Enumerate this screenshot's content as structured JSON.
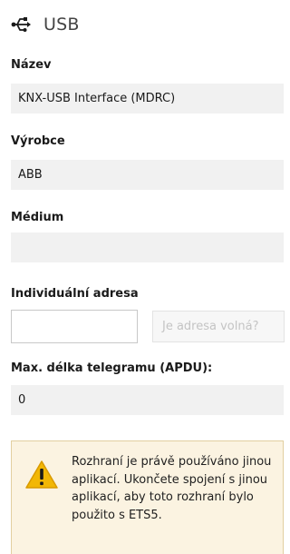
{
  "header": {
    "title": "USB",
    "icon": "usb-icon"
  },
  "name": {
    "label": "Název",
    "value": "KNX-USB Interface (MDRC)"
  },
  "manufacturer": {
    "label": "Výrobce",
    "value": "ABB"
  },
  "medium": {
    "label": "Médium",
    "value": ""
  },
  "individual_address": {
    "label": "Individuální adresa",
    "value": "",
    "check_button": "Je adresa volná?"
  },
  "max_length": {
    "label": "Max. délka telegramu (APDU):",
    "value": "0"
  },
  "warning": {
    "icon": "warning-icon",
    "text": "Rozhraní je právě používáno jinou aplikací. Ukončete spojení s jinou aplikací, aby toto rozhraní bylo použito s ETS5.",
    "colors": {
      "background": "#fbf3e1",
      "icon_fill": "#f2b705"
    }
  }
}
